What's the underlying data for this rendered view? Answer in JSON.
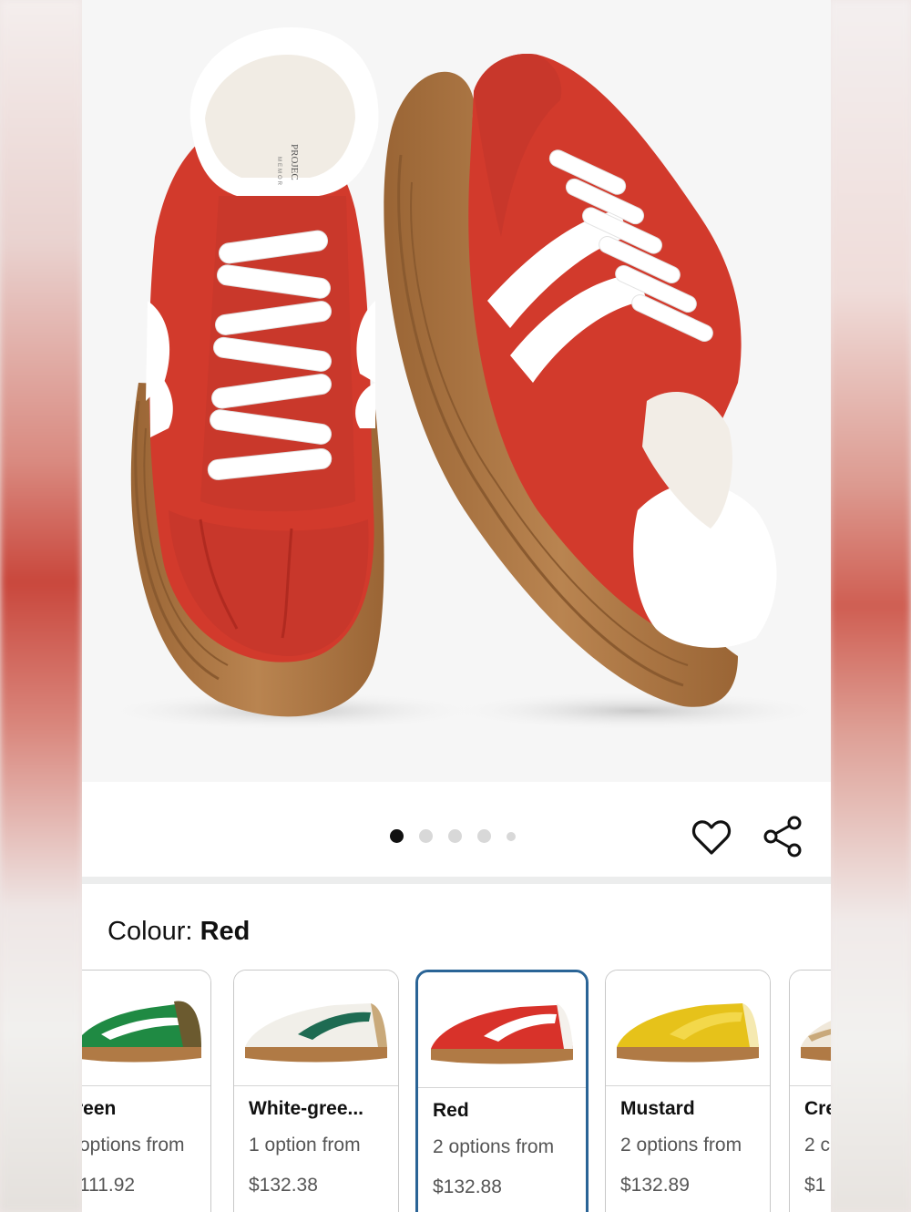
{
  "gallery": {
    "image_count": 5,
    "active_index": 0,
    "insole_brand_text": "PROJEC",
    "insole_sub_text": "MEMOR"
  },
  "actions": {
    "wishlist_icon": "heart-icon",
    "share_icon": "share-icon"
  },
  "colour": {
    "label": "Colour:",
    "selected": "Red"
  },
  "swatches": [
    {
      "name": "reen",
      "options": "options from",
      "price": "111.92",
      "upper": "#1f8a43",
      "accent": "#6b5a2f"
    },
    {
      "name": "White-gree...",
      "options": "1 option from",
      "price": "$132.38",
      "upper": "#f1efe9",
      "accent": "#1e6b52"
    },
    {
      "name": "Red",
      "options": "2 options from",
      "price": "$132.88",
      "upper": "#d8322a",
      "accent": "#ffffff"
    },
    {
      "name": "Mustard",
      "options": "2 options from",
      "price": "$132.89",
      "upper": "#e6c21a",
      "accent": "#f3d84a"
    },
    {
      "name": "Cre",
      "options": "2 c",
      "price": "$1",
      "upper": "#f0e8da",
      "accent": "#c9a97a"
    }
  ],
  "colors": {
    "selected_border": "#2a6496",
    "shoe_red": "#d23a2c",
    "sole_gum": "#b07a45"
  }
}
